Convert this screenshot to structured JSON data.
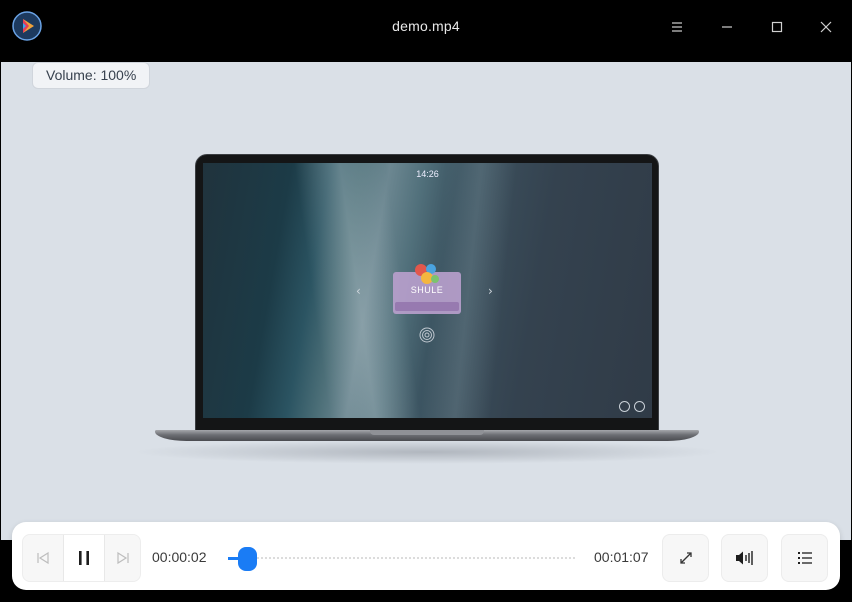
{
  "window": {
    "title": "demo.mp4",
    "app_icon": "movie-player-logo-icon",
    "buttons": [
      "menu-icon",
      "minimize-icon",
      "maximize-icon",
      "close-icon"
    ]
  },
  "osd": {
    "text": "Volume: 100%"
  },
  "video_frame": {
    "lock_time": "14:26",
    "user_name": "SHULE"
  },
  "controls": {
    "current_time": "00:00:02",
    "total_time": "00:01:07",
    "progress_fraction": 0.03,
    "accent_color": "#1a7cf5",
    "buttons": [
      "previous-icon",
      "pause-icon",
      "next-icon",
      "fullscreen-icon",
      "volume-icon",
      "playlist-icon"
    ]
  }
}
